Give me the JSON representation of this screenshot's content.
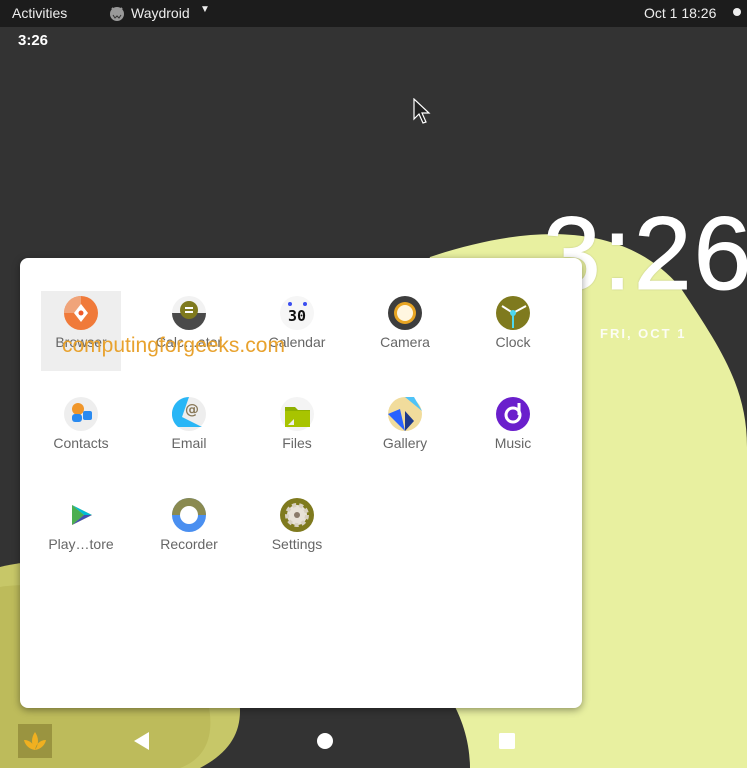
{
  "topbar": {
    "activities": "Activities",
    "app_name": "Waydroid",
    "clock": "Oct 1  18:26"
  },
  "android": {
    "status_time": "3:26",
    "lock_clock": "3:26",
    "lock_date": "FRI, OCT 1"
  },
  "apps": [
    {
      "label": "Browser",
      "icon": "browser-icon"
    },
    {
      "label": "Calc…ator",
      "icon": "calculator-icon"
    },
    {
      "label": "Calendar",
      "icon": "calendar-icon",
      "icon_text": "30"
    },
    {
      "label": "Camera",
      "icon": "camera-icon"
    },
    {
      "label": "Clock",
      "icon": "clock-icon"
    },
    {
      "label": "Contacts",
      "icon": "contacts-icon"
    },
    {
      "label": "Email",
      "icon": "email-icon",
      "icon_text": "@"
    },
    {
      "label": "Files",
      "icon": "files-icon"
    },
    {
      "label": "Gallery",
      "icon": "gallery-icon"
    },
    {
      "label": "Music",
      "icon": "music-icon"
    },
    {
      "label": "Play…tore",
      "icon": "play-store-icon"
    },
    {
      "label": "Recorder",
      "icon": "recorder-icon"
    },
    {
      "label": "Settings",
      "icon": "settings-icon"
    }
  ],
  "watermark": "computingforgeeks.com"
}
